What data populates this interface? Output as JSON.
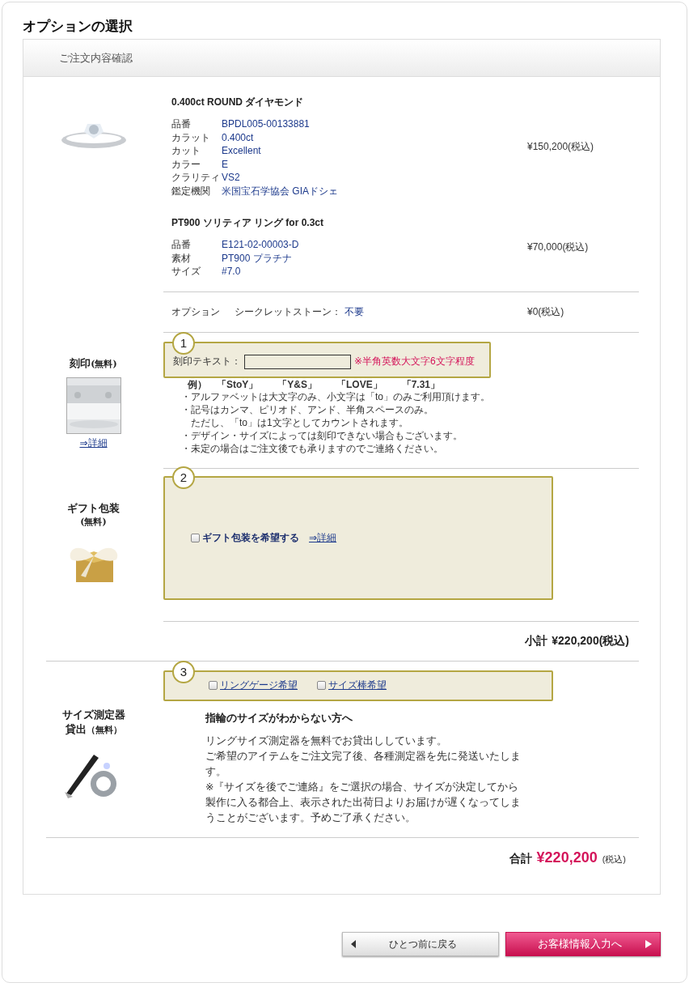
{
  "page_title": "オプションの選択",
  "panel_header": "ご注文内容確認",
  "products": [
    {
      "name": "0.400ct ROUND ダイヤモンド",
      "price": "¥150,200(税込)",
      "specs": [
        {
          "label": "品番",
          "value": "BPDL005-00133881"
        },
        {
          "label": "カラット",
          "value": "0.400ct"
        },
        {
          "label": "カット",
          "value": "Excellent"
        },
        {
          "label": "カラー",
          "value": "E"
        },
        {
          "label": "クラリティ",
          "value": "VS2"
        },
        {
          "label": "鑑定機関",
          "value": "米国宝石学協会 GIAドシェ"
        }
      ]
    },
    {
      "name": "PT900 ソリティア リング for 0.3ct",
      "price": "¥70,000(税込)",
      "specs": [
        {
          "label": "品番",
          "value": "E121-02-00003-D"
        },
        {
          "label": "素材",
          "value": "PT900 プラチナ"
        },
        {
          "label": "サイズ",
          "value": "#7.0"
        }
      ]
    }
  ],
  "option": {
    "label": "オプション",
    "name": "シークレットストーン：",
    "value": "不要",
    "price": "¥0(税込)"
  },
  "engraving": {
    "title": "刻印",
    "fee": "(無料)",
    "detail_link": "⇒詳細",
    "step": "1",
    "field_label": "刻印テキスト：",
    "hint": "※半角英数大文字6文字程度",
    "examples": "例）　「StoY」　　「Y&S」　　「LOVE」　　「7.31」",
    "rules": [
      {
        "kind": "bullet",
        "text": "・アルファベットは大文字のみ、小文字は「to」のみご利用頂けます。"
      },
      {
        "kind": "bullet",
        "text": "・記号はカンマ、ピリオド、アンド、半角スペースのみ。"
      },
      {
        "kind": "continuation",
        "text": "ただし、「to」は1文字としてカウントされます。"
      },
      {
        "kind": "bullet",
        "text": "・デザイン・サイズによっては刻印できない場合もございます。"
      },
      {
        "kind": "bullet",
        "text": "・未定の場合はご注文後でも承りますのでご連絡ください。"
      }
    ]
  },
  "gift": {
    "title": "ギフト包装",
    "fee": "(無料)",
    "step": "2",
    "checkbox": {
      "label": "ギフト包装を希望する",
      "checked": false
    },
    "detail_link": "⇒詳細"
  },
  "subtotal": {
    "label": "小計",
    "amount": "¥220,200(税込)"
  },
  "size_tool": {
    "title": "サイズ測定器",
    "title_2": "貸出",
    "fee": "（無料）",
    "step": "3",
    "options": [
      {
        "label": "リングゲージ希望",
        "checked": false
      },
      {
        "label": "サイズ棒希望",
        "checked": false
      }
    ],
    "heading": "指輪のサイズがわからない方へ",
    "paragraphs": [
      "リングサイズ測定器を無料でお貸出ししています。",
      "ご希望のアイテムをご注文完了後、各種測定器を先に発送いたします。",
      "※『サイズを後でご連絡』をご選択の場合、サイズが決定してから製作に入る都合上、表示された出荷日よりお届けが遅くなってしまうことがございます。予めご了承ください。"
    ]
  },
  "total": {
    "label": "合計",
    "amount": "¥220,200",
    "tax": "(税込)"
  },
  "buttons": [
    {
      "kind": "back",
      "label": "ひとつ前に戻る"
    },
    {
      "kind": "next",
      "label": "お客様情報入力へ"
    }
  ]
}
